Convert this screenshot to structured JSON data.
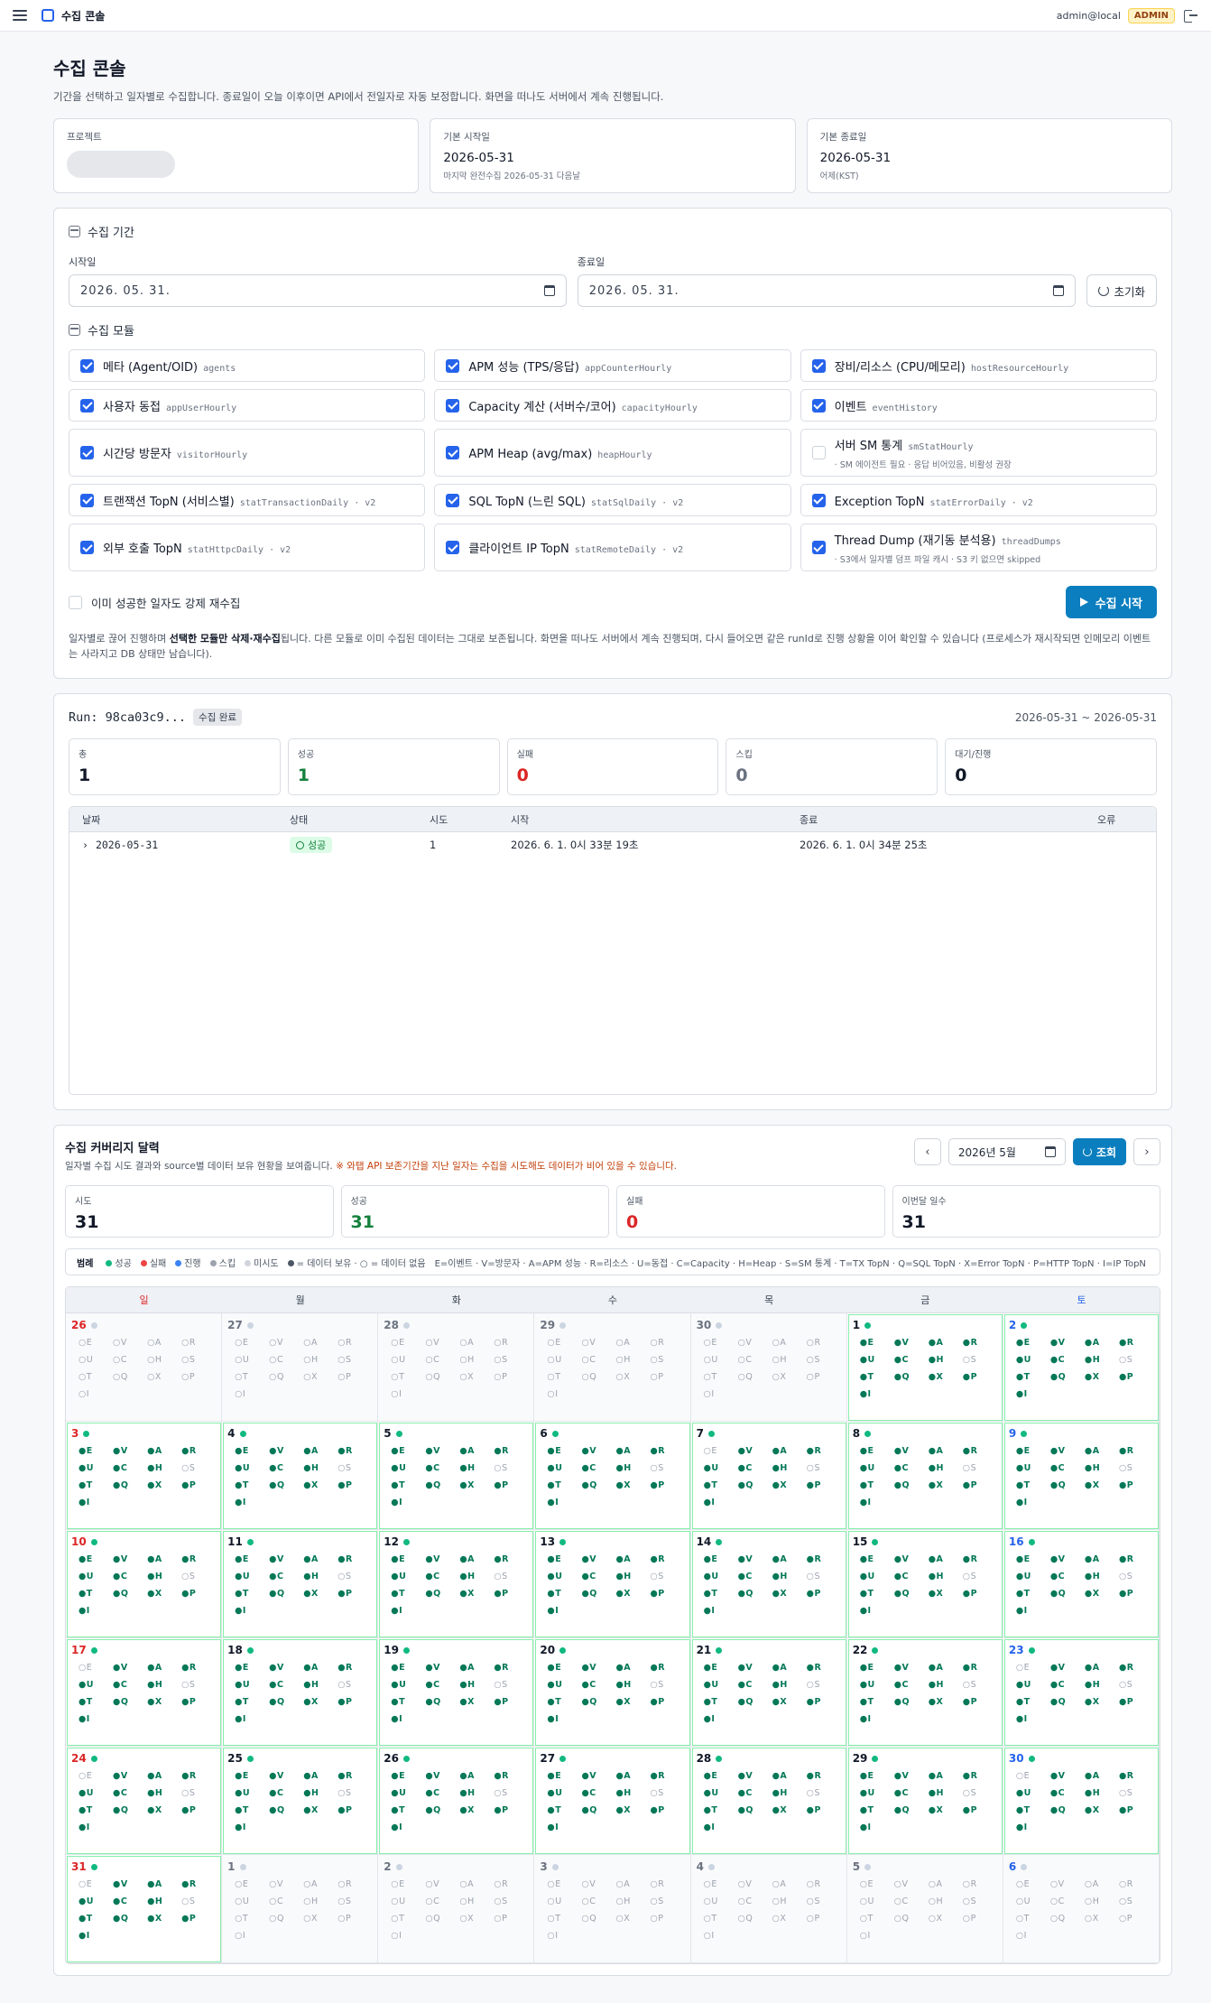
{
  "topbar": {
    "title": "수집 콘솔",
    "user": "admin@local",
    "role": "ADMIN"
  },
  "header": {
    "title": "수집 콘솔",
    "description": "기간을 선택하고 일자별로 수집합니다. 종료일이 오늘 이후이면 API에서 전일자로 자동 보정합니다. 화면을 떠나도 서버에서 계속 진행됩니다."
  },
  "info": {
    "project_label": "프로젝트",
    "start_label": "기본 시작일",
    "start_value": "2026-05-31",
    "start_sub": "마지막 완전수집 2026-05-31 다음날",
    "end_label": "기본 종료일",
    "end_value": "2026-05-31",
    "end_sub": "어제(KST)"
  },
  "range": {
    "title": "수집 기간",
    "start_label": "시작일",
    "start_value": "2026. 05. 31.",
    "end_label": "종료일",
    "end_value": "2026. 05. 31.",
    "reset_label": "초기화",
    "modules_title": "수집 모듈",
    "modules": [
      {
        "name": "메타 (Agent/OID)",
        "key": "agents",
        "note": "",
        "checked": true
      },
      {
        "name": "APM 성능 (TPS/응답)",
        "key": "appCounterHourly",
        "note": "",
        "checked": true
      },
      {
        "name": "장비/리소스 (CPU/메모리)",
        "key": "hostResourceHourly",
        "note": "",
        "checked": true
      },
      {
        "name": "사용자 동접",
        "key": "appUserHourly",
        "note": "",
        "checked": true
      },
      {
        "name": "Capacity 계산 (서버수/코어)",
        "key": "capacityHourly",
        "note": "",
        "checked": true
      },
      {
        "name": "이벤트",
        "key": "eventHistory",
        "note": "",
        "checked": true
      },
      {
        "name": "시간당 방문자",
        "key": "visitorHourly",
        "note": "",
        "checked": true
      },
      {
        "name": "APM Heap (avg/max)",
        "key": "heapHourly",
        "note": "",
        "checked": true
      },
      {
        "name": "서버 SM 통계",
        "key": "smStatHourly",
        "note": "· SM 에이전트 필요 · 응답 비어있음, 비활성 권장",
        "checked": false
      },
      {
        "name": "트랜잭션 TopN (서비스별)",
        "key": "statTransactionDaily · v2",
        "note": "",
        "checked": true
      },
      {
        "name": "SQL TopN (느린 SQL)",
        "key": "statSqlDaily · v2",
        "note": "",
        "checked": true
      },
      {
        "name": "Exception TopN",
        "key": "statErrorDaily · v2",
        "note": "",
        "checked": true
      },
      {
        "name": "외부 호출 TopN",
        "key": "statHttpcDaily · v2",
        "note": "",
        "checked": true
      },
      {
        "name": "클라이언트 IP TopN",
        "key": "statRemoteDaily · v2",
        "note": "",
        "checked": true
      },
      {
        "name": "Thread Dump (재기동 분석용)",
        "key": "threadDumps",
        "note": "· S3에서 일자별 덤프 파일 캐시 · S3 키 없으면 skipped",
        "checked": true
      }
    ],
    "force_label": "이미 성공한 일자도 강제 재수집",
    "start_button": "수집 시작",
    "hint_pre": "일자별로 끊어 진행하며 ",
    "hint_bold": "선택한 모듈만 삭제·재수집",
    "hint_post": "됩니다. 다른 모듈로 이미 수집된 데이터는 그대로 보존됩니다. 화면을 떠나도 서버에서 계속 진행되며, 다시 들어오면 같은 runId로 진행 상황을 이어 확인할 수 있습니다 (프로세스가 재시작되면 인메모리 이벤트는 사라지고 DB 상태만 남습니다)."
  },
  "run": {
    "label": "Run: 98ca03c9...",
    "status": "수집 완료",
    "period": "2026-05-31 ~ 2026-05-31",
    "stats": [
      {
        "label": "총",
        "value": "1",
        "tone": "def"
      },
      {
        "label": "성공",
        "value": "1",
        "tone": "ok"
      },
      {
        "label": "실패",
        "value": "0",
        "tone": "fail"
      },
      {
        "label": "스킵",
        "value": "0",
        "tone": "skip"
      },
      {
        "label": "대기/진행",
        "value": "0",
        "tone": "def"
      }
    ],
    "columns": [
      "날짜",
      "상태",
      "시도",
      "시작",
      "종료",
      "오류"
    ],
    "rows": [
      {
        "date": "2026-05-31",
        "status": "성공",
        "attempts": "1",
        "start": "2026. 6. 1. 0시 33분 19초",
        "end": "2026. 6. 1. 0시 34분 25초",
        "error": ""
      }
    ]
  },
  "calendar": {
    "title": "수집 커버리지 달력",
    "subtitle": "일자별 수집 시도 결과와 source별 데이터 보유 현황을 보여줍니다.",
    "warning": "※ 와탭 API 보존기간을 지난 일자는 수집을 시도해도 데이터가 비어 있을 수 있습니다.",
    "month": "2026년 5월",
    "query_label": "조회",
    "prev": "‹",
    "next": "›",
    "stats": [
      {
        "label": "시도",
        "value": "31",
        "tone": "def"
      },
      {
        "label": "성공",
        "value": "31",
        "tone": "ok"
      },
      {
        "label": "실패",
        "value": "0",
        "tone": "fail"
      },
      {
        "label": "이번달 일수",
        "value": "31",
        "tone": "def"
      }
    ],
    "legend": {
      "title": "범례",
      "items": [
        {
          "label": "성공",
          "color": "#10b981"
        },
        {
          "label": "실패",
          "color": "#ef4444"
        },
        {
          "label": "진행",
          "color": "#3b82f6"
        },
        {
          "label": "스킵",
          "color": "#9ca3af"
        },
        {
          "label": "미시도",
          "color": "#d1d5db"
        }
      ],
      "dot_note": "= 데이터 보유 · ○ = 데이터 없음",
      "abbr": "E=이벤트 · V=방문자 · A=APM 성능 · R=리소스 · U=동접 · C=Capacity · H=Heap · S=SM 통계 · T=TX TopN · Q=SQL TopN · X=Error TopN · P=HTTP TopN · I=IP TopN"
    },
    "weekdays": [
      "일",
      "월",
      "화",
      "수",
      "목",
      "금",
      "토"
    ],
    "codes": [
      "E",
      "V",
      "A",
      "R",
      "U",
      "C",
      "H",
      "S",
      "T",
      "Q",
      "X",
      "P",
      "I"
    ],
    "days": [
      {
        "d": "26",
        "m": "other",
        "has": ""
      },
      {
        "d": "27",
        "m": "other",
        "has": ""
      },
      {
        "d": "28",
        "m": "other",
        "has": ""
      },
      {
        "d": "29",
        "m": "other",
        "has": ""
      },
      {
        "d": "30",
        "m": "other",
        "has": ""
      },
      {
        "d": "1",
        "m": "cur",
        "has": "EVARUCHTQXPI"
      },
      {
        "d": "2",
        "m": "cur",
        "has": "EVARUCHTQXPI"
      },
      {
        "d": "3",
        "m": "cur",
        "has": "EVARUCHTQXPI"
      },
      {
        "d": "4",
        "m": "cur",
        "has": "EVARUCHTQXPI"
      },
      {
        "d": "5",
        "m": "cur",
        "has": "EVARUCHTQXPI"
      },
      {
        "d": "6",
        "m": "cur",
        "has": "EVARUCHTQXPI"
      },
      {
        "d": "7",
        "m": "cur",
        "has": "VARUCHTQXPI"
      },
      {
        "d": "8",
        "m": "cur",
        "has": "EVARUCHTQXPI"
      },
      {
        "d": "9",
        "m": "cur",
        "has": "EVARUCHTQXPI"
      },
      {
        "d": "10",
        "m": "cur",
        "has": "EVARUCHTQXPI"
      },
      {
        "d": "11",
        "m": "cur",
        "has": "EVARUCHTQXPI"
      },
      {
        "d": "12",
        "m": "cur",
        "has": "EVARUCHTQXPI"
      },
      {
        "d": "13",
        "m": "cur",
        "has": "EVARUCHTQXPI"
      },
      {
        "d": "14",
        "m": "cur",
        "has": "EVARUCHTQXPI"
      },
      {
        "d": "15",
        "m": "cur",
        "has": "EVARUCHTQXPI"
      },
      {
        "d": "16",
        "m": "cur",
        "has": "EVARUCHTQXPI"
      },
      {
        "d": "17",
        "m": "cur",
        "has": "VARUCHTQXPI"
      },
      {
        "d": "18",
        "m": "cur",
        "has": "EVARUCHTQXPI"
      },
      {
        "d": "19",
        "m": "cur",
        "has": "EVARUCHTQXPI"
      },
      {
        "d": "20",
        "m": "cur",
        "has": "EVARUCHTQXPI"
      },
      {
        "d": "21",
        "m": "cur",
        "has": "EVARUCHTQXPI"
      },
      {
        "d": "22",
        "m": "cur",
        "has": "EVARUCHTQXPI"
      },
      {
        "d": "23",
        "m": "cur",
        "has": "VARUCHTQXPI"
      },
      {
        "d": "24",
        "m": "cur",
        "has": "VARUCHTQXPI"
      },
      {
        "d": "25",
        "m": "cur",
        "has": "EVARUCHTQXPI"
      },
      {
        "d": "26",
        "m": "cur",
        "has": "EVARUCHTQXPI"
      },
      {
        "d": "27",
        "m": "cur",
        "has": "EVARUCHTQXPI"
      },
      {
        "d": "28",
        "m": "cur",
        "has": "EVARUCHTQXPI"
      },
      {
        "d": "29",
        "m": "cur",
        "has": "EVARUCHTQXPI"
      },
      {
        "d": "30",
        "m": "cur",
        "has": "VARUCHTQXPI"
      },
      {
        "d": "31",
        "m": "cur",
        "has": "VARUCHTQXPI"
      },
      {
        "d": "1",
        "m": "other",
        "has": ""
      },
      {
        "d": "2",
        "m": "other",
        "has": ""
      },
      {
        "d": "3",
        "m": "other",
        "has": ""
      },
      {
        "d": "4",
        "m": "other",
        "has": ""
      },
      {
        "d": "5",
        "m": "other",
        "has": ""
      },
      {
        "d": "6",
        "m": "other",
        "has": ""
      }
    ]
  }
}
